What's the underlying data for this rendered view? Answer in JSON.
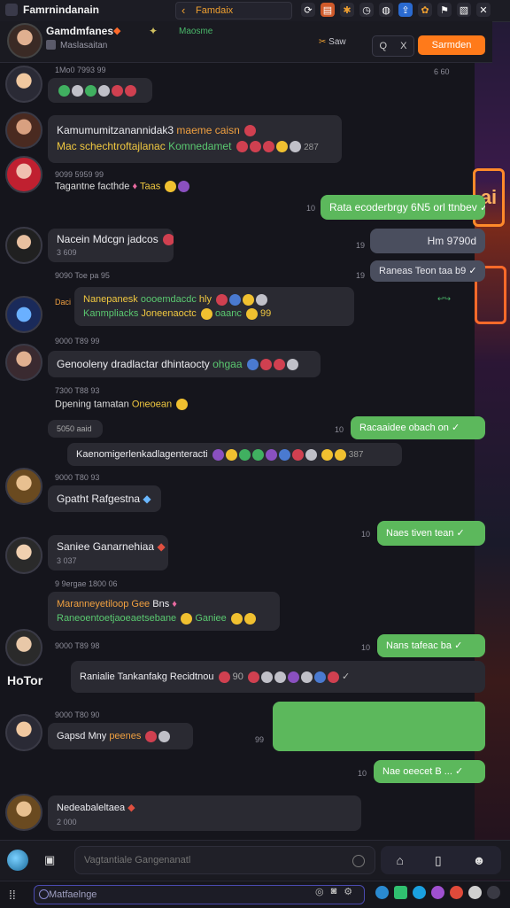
{
  "window": {
    "title": "Famrnindanain",
    "tab_label": "Famdaix"
  },
  "header": {
    "title": "Gamdmfanes",
    "subtitle": "Maslasaitan",
    "status": "Maosme",
    "filter_label": "Saw",
    "search_icons": [
      "Q",
      "X"
    ],
    "primary_button": "Sarmden"
  },
  "messages": [
    {
      "avatar": "av1",
      "ts": "1Mo0 7993 99",
      "text": "",
      "right_ts": "6 60"
    },
    {
      "avatar": "av2",
      "line1": "Kamumumitzanannidak3 ",
      "line1_accent": "maeme caisn",
      "line2": "Mac schechtroftajlanac ",
      "line2_accent": "Komnedamet",
      "line2_count": "287"
    },
    {
      "avatar": "av3",
      "ts": "9099 5959 99",
      "text": "Tagantne facthde",
      "accent": "Taas"
    },
    {
      "out_text": "Rata ecoderbrgy 6N5 orl ttnbev",
      "out_ts": "10"
    },
    {
      "avatar": "av4",
      "text": "Nacein Mdcgn jadcos",
      "sub": "3 609"
    },
    {
      "gray_text": "Hm 9790d",
      "gray_ts": "19"
    },
    {
      "ts": "9090 Toe pa 95",
      "gray_text": "Raneas Teon taa b9",
      "gray_ts": "19"
    },
    {
      "avatar": "av5",
      "prefix": "Daci",
      "line1": "Nanepanesk",
      "line1b": "oooemdacdc",
      "line1_accent": "hly",
      "line2": "Kanmpliacks",
      "line2_accent": "Joneenaoctc",
      "line2_tail": "oaanc",
      "line2_count": "99"
    },
    {
      "ts": "9000 T89 99",
      "avatar": "av6",
      "text": "Genooleny dradlactar dhintaocty",
      "accent": "ohgaa"
    },
    {
      "ts": "7300 T88 93",
      "text": "Dpening tamatan",
      "accent": "Oneoean"
    },
    {
      "small": "5050 aaid",
      "out_text": "Racaaidee obach on",
      "out_ts": "10"
    },
    {
      "text": "Kaenomigerlenkadlagenteracti",
      "count": "387"
    },
    {
      "ts": "9000 T80 93",
      "avatar": "av7",
      "text": "Gpatht Rafgestna"
    },
    {
      "out_text": "Naes tiven tean",
      "out_ts": "10"
    },
    {
      "avatar": "av8",
      "text": "Saniee Ganarnehiaa",
      "sub": "3 037"
    },
    {
      "ts": "9 9ergae 1800 06",
      "line1": "Maranneyetiloop Gee",
      "line1b": "Bns",
      "line2": "Raneoentoetjaoeaetsebane",
      "line2_accent": "Ganiee"
    },
    {
      "ts": "9000 T89 98",
      "out_text": "Nans tafeac ba",
      "out_ts": "10"
    },
    {
      "wide_text": "Ranialie Tankanfakg Recidtnou",
      "wide_count": "90",
      "tag": "HoTor"
    },
    {
      "ts": "9000 T80 90",
      "text": "Gapsd Mny",
      "accent": "peenes",
      "right_ts": "99"
    },
    {
      "out_text": "Nae oeecet B ...",
      "out_ts": "10"
    },
    {
      "text": "Nedeabaleltaea",
      "sub": "2 000"
    }
  ],
  "composer": {
    "placeholder": "Vagtantiale Gangenanatl",
    "tool_icons": [
      "home-icon",
      "clipboard-icon",
      "emoji-icon"
    ]
  },
  "taskbar": {
    "search_placeholder": "Matfaelnge"
  }
}
